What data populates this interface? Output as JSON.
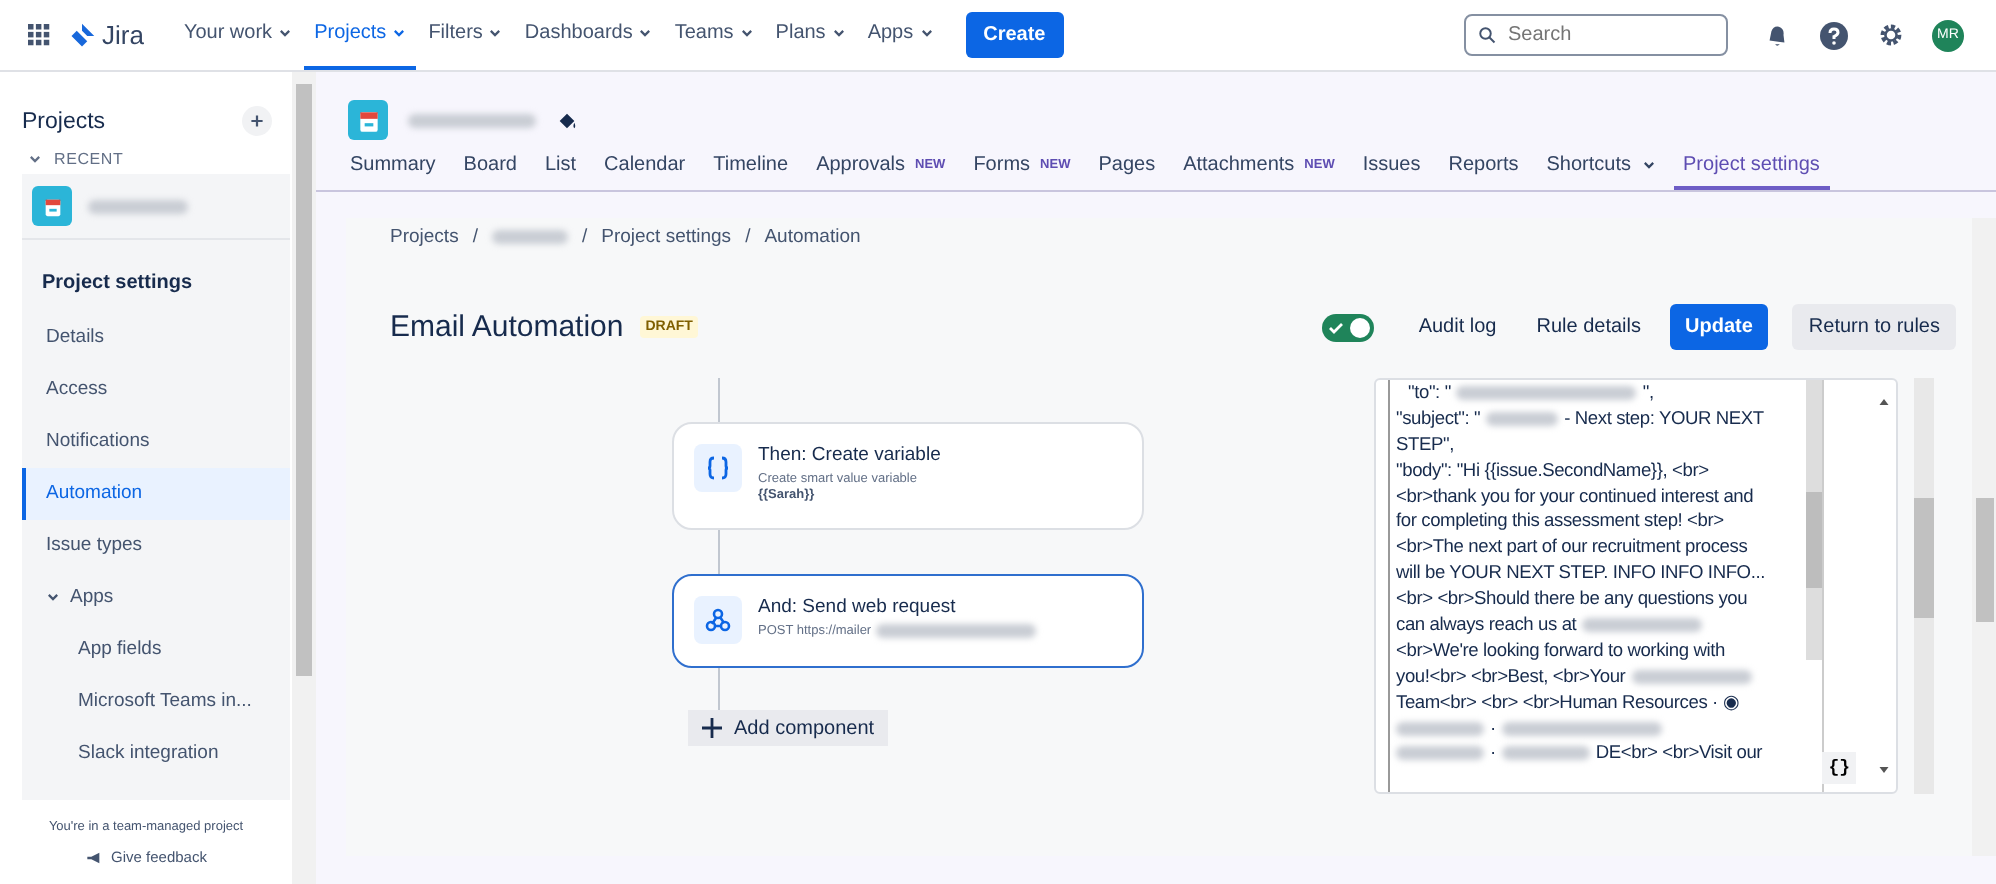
{
  "top_nav": {
    "product": "Jira",
    "items": [
      {
        "label": "Your work",
        "selected": false
      },
      {
        "label": "Projects",
        "selected": true
      },
      {
        "label": "Filters",
        "selected": false
      },
      {
        "label": "Dashboards",
        "selected": false
      },
      {
        "label": "Teams",
        "selected": false
      },
      {
        "label": "Plans",
        "selected": false
      },
      {
        "label": "Apps",
        "selected": false
      }
    ],
    "create": "Create",
    "search": {
      "placeholder": "Search"
    },
    "avatar": "MR"
  },
  "sidebar": {
    "title": "Projects",
    "recent": "RECENT",
    "section": "Project settings",
    "items": [
      {
        "label": "Details",
        "selected": false
      },
      {
        "label": "Access",
        "selected": false
      },
      {
        "label": "Notifications",
        "selected": false
      },
      {
        "label": "Automation",
        "selected": true
      },
      {
        "label": "Issue types",
        "selected": false
      },
      {
        "label": "Apps",
        "selected": false,
        "expanded": true,
        "children": [
          {
            "label": "App fields",
            "selected": false
          },
          {
            "label": "Microsoft Teams in...",
            "selected": false
          },
          {
            "label": "Slack integration",
            "selected": false
          }
        ]
      }
    ],
    "footer": "You're in a team-managed project",
    "feedback": "Give feedback"
  },
  "project_tabs": [
    {
      "label": "Summary",
      "selected": false
    },
    {
      "label": "Board",
      "selected": false
    },
    {
      "label": "List",
      "selected": false
    },
    {
      "label": "Calendar",
      "selected": false
    },
    {
      "label": "Timeline",
      "selected": false
    },
    {
      "label": "Approvals",
      "badge": "NEW",
      "selected": false
    },
    {
      "label": "Forms",
      "badge": "NEW",
      "selected": false
    },
    {
      "label": "Pages",
      "selected": false
    },
    {
      "label": "Attachments",
      "badge": "NEW",
      "selected": false
    },
    {
      "label": "Issues",
      "selected": false
    },
    {
      "label": "Reports",
      "selected": false
    },
    {
      "label": "Shortcuts",
      "dropdown": true,
      "selected": false
    },
    {
      "label": "Project settings",
      "selected": true
    }
  ],
  "breadcrumb": {
    "separator": "/",
    "items": [
      {
        "label": "Projects"
      },
      {
        "redacted": true
      },
      {
        "label": "Project settings"
      },
      {
        "label": "Automation"
      }
    ]
  },
  "rule": {
    "title": "Email Automation",
    "status": "DRAFT",
    "enabled": true,
    "actions": [
      "Audit log",
      "Rule details",
      "Update",
      "Return to rules"
    ],
    "steps": [
      {
        "kind": "variable",
        "title": "Then: Create variable",
        "subtitle": "Create smart value variable",
        "detail": "{{Sarah}}",
        "selected": false
      },
      {
        "kind": "webhook",
        "title": "And: Send web request",
        "subtitle": "POST https://mailer",
        "redacted": true,
        "selected": true
      }
    ],
    "add": "Add component"
  },
  "editor": {
    "lines": [
      {
        "parts": [
          "\"to\": \"",
          "\","
        ]
      },
      {
        "parts": [
          "\"subject\": \"",
          "- Next step: YOUR NEXT"
        ]
      },
      {
        "parts": [
          "STEP\","
        ]
      },
      {
        "parts": [
          "\"body\": \"Hi {{issue.SecondName}}, <br>"
        ]
      },
      {
        "parts": [
          "<br>thank you for your continued interest and"
        ]
      },
      {
        "parts": [
          "for completing this assessment step!  <br>"
        ]
      },
      {
        "parts": [
          "<br>The next part of our recruitment process"
        ]
      },
      {
        "parts": [
          "will be YOUR NEXT STEP. INFO INFO INFO..."
        ]
      },
      {
        "parts": [
          "<br> <br>Should there be any questions you"
        ]
      },
      {
        "parts": [
          "can always reach us at"
        ],
        "redacted_end": true
      },
      {
        "parts": [
          "<br>We're looking forward to working with"
        ]
      },
      {
        "parts": [
          "you!<br> <br>Best, <br>Your"
        ],
        "redacted_end": true
      },
      {
        "parts": [
          "Team<br> <br> <br>Human Resources · ◉"
        ]
      },
      {
        "parts": [
          "·"
        ],
        "redacted_start": true,
        "redacted_end": true
      },
      {
        "parts": [
          "·",
          "DE<br> <br>Visit our"
        ],
        "redacted_start": true
      }
    ],
    "insert": "{}"
  }
}
